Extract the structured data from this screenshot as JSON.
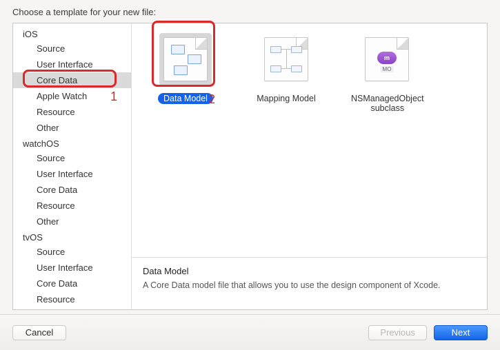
{
  "header": {
    "title": "Choose a template for your new file:"
  },
  "sidebar": {
    "sections": [
      {
        "title": "iOS",
        "items": [
          "Source",
          "User Interface",
          "Core Data",
          "Apple Watch",
          "Resource",
          "Other"
        ],
        "selectedIndex": 2
      },
      {
        "title": "watchOS",
        "items": [
          "Source",
          "User Interface",
          "Core Data",
          "Resource",
          "Other"
        ]
      },
      {
        "title": "tvOS",
        "items": [
          "Source",
          "User Interface",
          "Core Data",
          "Resource"
        ]
      }
    ]
  },
  "templates": {
    "items": [
      {
        "label": "Data Model",
        "kind": "data-model",
        "selected": true
      },
      {
        "label": "Mapping Model",
        "kind": "mapping-model",
        "selected": false
      },
      {
        "label": "NSManagedObject subclass",
        "kind": "nsmanagedobject",
        "selected": false
      }
    ]
  },
  "description": {
    "title": "Data Model",
    "body": "A Core Data model file that allows you to use the design component of Xcode."
  },
  "footer": {
    "cancel": "Cancel",
    "previous": "Previous",
    "next": "Next"
  },
  "annotations": {
    "box1": {
      "label": "1"
    },
    "box2": {
      "label": "2"
    }
  }
}
